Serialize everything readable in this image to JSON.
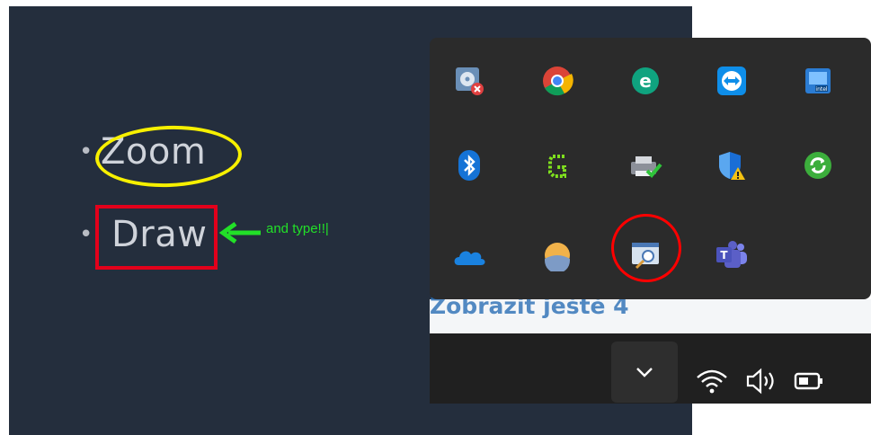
{
  "slide": {
    "items": [
      {
        "label": "Zoom"
      },
      {
        "label": "Draw"
      }
    ],
    "bullet": "•",
    "annotation": "and type!!|",
    "colors": {
      "background": "#242e3d",
      "zoom_highlight": "#f7f000",
      "draw_highlight": "#e3001b",
      "annotation": "#22e028"
    }
  },
  "tray": {
    "icons": [
      {
        "name": "disc-error-icon"
      },
      {
        "name": "chrome-icon"
      },
      {
        "name": "eset-icon"
      },
      {
        "name": "teamviewer-icon"
      },
      {
        "name": "intel-graphics-icon"
      },
      {
        "name": "bluetooth-icon"
      },
      {
        "name": "greenshot-icon"
      },
      {
        "name": "printer-check-icon"
      },
      {
        "name": "defender-warning-icon"
      },
      {
        "name": "sync-icon"
      },
      {
        "name": "onedrive-icon"
      },
      {
        "name": "weather-icon"
      },
      {
        "name": "zoomit-icon"
      },
      {
        "name": "teams-icon"
      }
    ],
    "more_text": "Zobrazit ještě 4"
  },
  "taskbar": {
    "icons": [
      "chevron-up-icon",
      "wifi-icon",
      "volume-icon",
      "battery-icon"
    ]
  }
}
